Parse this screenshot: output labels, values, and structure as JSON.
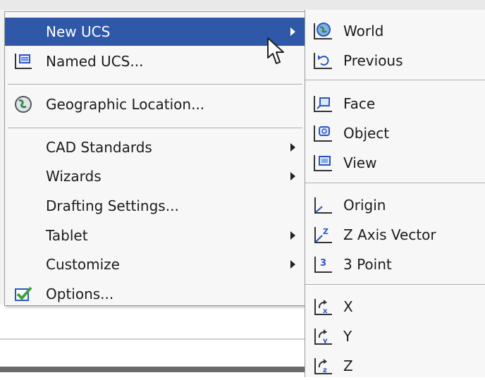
{
  "main_menu": {
    "items": [
      {
        "label": "New UCS",
        "icon": "none",
        "submenu": true,
        "highlighted": true
      },
      {
        "label": "Named UCS...",
        "icon": "named-ucs-icon",
        "submenu": false
      },
      {
        "label": "Geographic Location...",
        "icon": "globe-icon",
        "submenu": false
      },
      {
        "label": "CAD Standards",
        "icon": "none",
        "submenu": true
      },
      {
        "label": "Wizards",
        "icon": "none",
        "submenu": true
      },
      {
        "label": "Drafting Settings...",
        "icon": "none",
        "submenu": false
      },
      {
        "label": "Tablet",
        "icon": "none",
        "submenu": true
      },
      {
        "label": "Customize",
        "icon": "none",
        "submenu": true
      },
      {
        "label": "Options...",
        "icon": "options-check-icon",
        "submenu": false
      }
    ]
  },
  "submenu": {
    "items": [
      {
        "label": "World",
        "icon": "world-ucs-icon"
      },
      {
        "label": "Previous",
        "icon": "previous-ucs-icon"
      },
      {
        "label": "Face",
        "icon": "face-ucs-icon"
      },
      {
        "label": "Object",
        "icon": "object-ucs-icon"
      },
      {
        "label": "View",
        "icon": "view-ucs-icon"
      },
      {
        "label": "Origin",
        "icon": "origin-ucs-icon"
      },
      {
        "label": "Z Axis Vector",
        "icon": "z-axis-vector-icon"
      },
      {
        "label": "3 Point",
        "icon": "three-point-icon"
      },
      {
        "label": "X",
        "icon": "rotate-x-icon"
      },
      {
        "label": "Y",
        "icon": "rotate-y-icon"
      },
      {
        "label": "Z",
        "icon": "rotate-z-icon"
      }
    ]
  },
  "colors": {
    "highlight": "#2f58a8",
    "menu_bg": "#f7f7f7",
    "icon_blue": "#2a55c4",
    "check_green": "#3aa33a"
  }
}
